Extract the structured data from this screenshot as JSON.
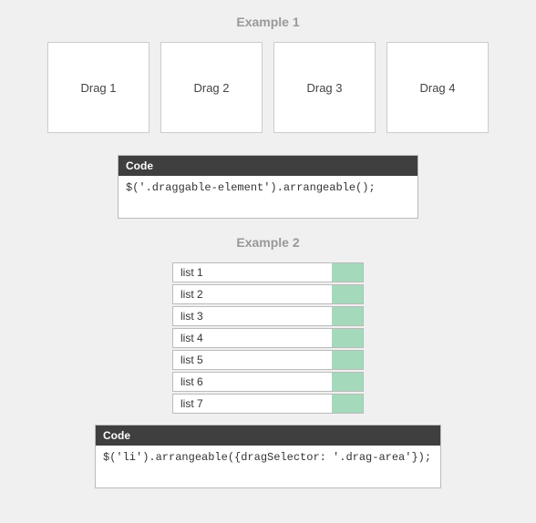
{
  "example1": {
    "title": "Example 1",
    "boxes": [
      "Drag 1",
      "Drag 2",
      "Drag 3",
      "Drag 4"
    ],
    "code_label": "Code",
    "code_body": "$('.draggable-element').arrangeable();"
  },
  "example2": {
    "title": "Example 2",
    "items": [
      "list 1",
      "list 2",
      "list 3",
      "list 4",
      "list 5",
      "list 6",
      "list 7"
    ],
    "code_label": "Code",
    "code_body": "$('li').arrangeable({dragSelector: '.drag-area'});"
  }
}
